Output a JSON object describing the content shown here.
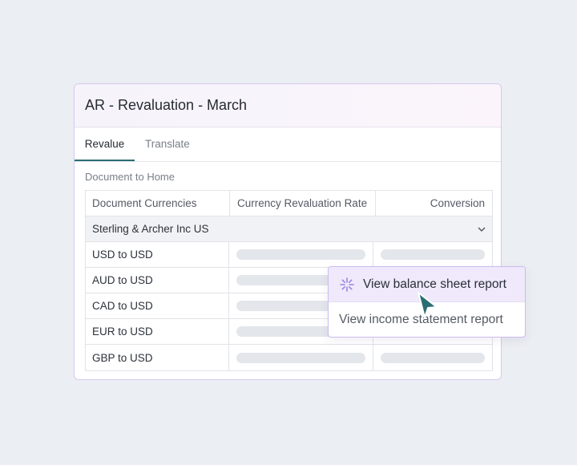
{
  "card": {
    "title": "AR - Revaluation - March"
  },
  "tabs": [
    {
      "label": "Revalue",
      "active": true
    },
    {
      "label": "Translate",
      "active": false
    }
  ],
  "section_label": "Document to Home",
  "table": {
    "headers": [
      "Document Currencies",
      "Currency Revaluation Rate",
      "Conversion"
    ],
    "group": "Sterling & Archer Inc US",
    "rows": [
      {
        "currency": "USD to USD"
      },
      {
        "currency": "AUD to USD"
      },
      {
        "currency": "CAD to USD"
      },
      {
        "currency": "EUR to USD"
      },
      {
        "currency": "GBP to USD"
      }
    ]
  },
  "popover": {
    "items": [
      {
        "label": "View balance sheet report",
        "icon": "sparkle-icon"
      },
      {
        "label": "View income statement report"
      }
    ]
  },
  "colors": {
    "accent_tab": "#2a6e74",
    "popover_border": "#cbbcf0",
    "popover_active_bg": "#efe9fb",
    "cursor": "#2a6e74"
  }
}
